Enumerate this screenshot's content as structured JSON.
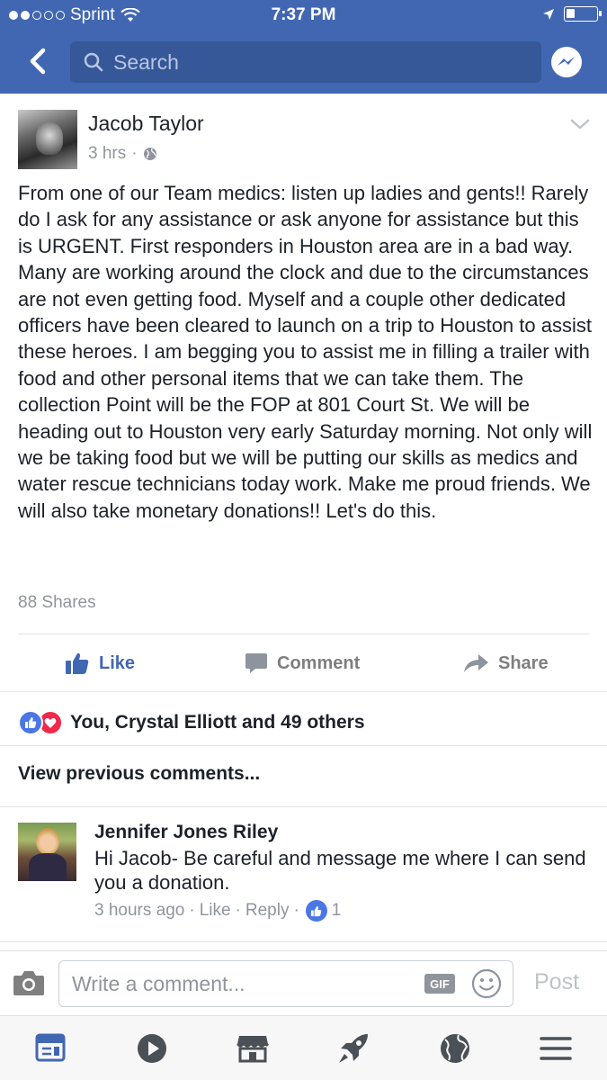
{
  "status_bar": {
    "carrier": "Sprint",
    "time": "7:37 PM"
  },
  "header": {
    "search_placeholder": "Search"
  },
  "post": {
    "author": "Jacob Taylor",
    "time": "3 hrs",
    "text": "From one of our Team medics: listen up ladies and gents!! Rarely do I ask for any assistance or ask anyone for assistance but this is URGENT. First responders in Houston area are in a bad way. Many are working around the clock and due to the circumstances are not even getting food. Myself and a couple other dedicated officers have been cleared to launch on a trip to Houston to assist these heroes. I am begging you to assist me in filling a trailer with food and other personal items that we can take them. The collection Point will be the FOP at 801 Court St. We will be heading out to Houston very early Saturday morning. Not only will we be taking food but we will be putting our skills as medics and water rescue technicians today work. Make me proud friends. We will also take monetary donations!! Let's do this.",
    "shares": "88 Shares"
  },
  "actions": {
    "like": "Like",
    "comment": "Comment",
    "share": "Share"
  },
  "reactions_text": "You, Crystal Elliott and 49 others",
  "view_previous": "View previous comments...",
  "comment": {
    "author": "Jennifer Jones Riley",
    "text": "Hi Jacob- Be careful and message me where I can send you a donation.",
    "time": "3 hours ago",
    "like": "Like",
    "reply": "Reply",
    "like_count": "1"
  },
  "composer": {
    "placeholder": "Write a comment...",
    "gif": "GIF",
    "post": "Post"
  },
  "colors": {
    "brand": "#4267b2",
    "like_blue": "#4b77e6",
    "love_red": "#f0284a"
  },
  "icons": {
    "tabs": [
      "news-feed-icon",
      "video-icon",
      "marketplace-icon",
      "explore-rocket-icon",
      "globe-notifications-icon",
      "menu-icon"
    ]
  }
}
